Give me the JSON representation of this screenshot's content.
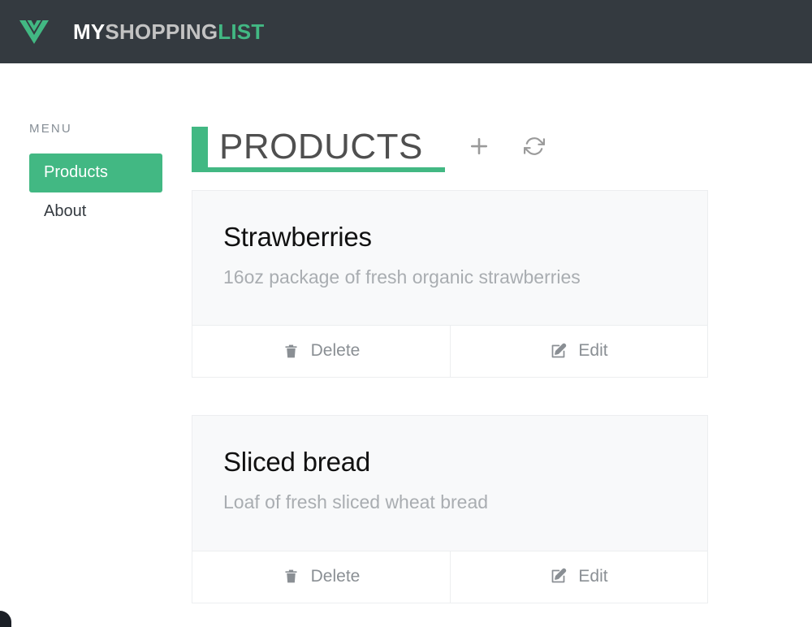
{
  "navbar": {
    "logo_icon": "vue-logo-icon",
    "brand": {
      "part1": "MY",
      "part2": "SHOPPING",
      "part3": "LIST"
    }
  },
  "sidebar": {
    "label": "MENU",
    "items": [
      {
        "label": "Products",
        "active": true
      },
      {
        "label": "About",
        "active": false
      }
    ]
  },
  "main": {
    "title": "PRODUCTS",
    "actions": [
      {
        "name": "add-product-button",
        "icon": "plus-icon"
      },
      {
        "name": "refresh-products-button",
        "icon": "refresh-icon"
      }
    ],
    "buttons": {
      "delete_label": "Delete",
      "edit_label": "Edit",
      "delete_icon": "trash-icon",
      "edit_icon": "edit-pencil-icon"
    },
    "products": [
      {
        "title": "Strawberries",
        "description": "16oz package of fresh organic strawberries"
      },
      {
        "title": "Sliced bread",
        "description": "Loaf of fresh sliced wheat bread"
      }
    ]
  },
  "colors": {
    "accent_green": "#42b883",
    "navbar_dark": "#343a40",
    "card_body": "#f8f9fa",
    "muted_text": "#a9adb1"
  }
}
